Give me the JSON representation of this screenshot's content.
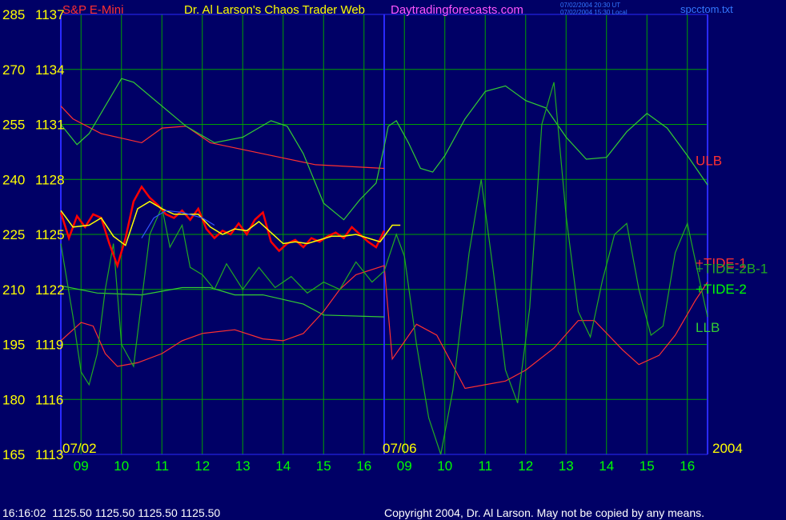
{
  "header": {
    "instrument": "S&P E-Mini",
    "title": "Dr. Al Larson's Chaos Trader Web",
    "site": "Daytradingforecasts.com",
    "timestamp_ut": "07/02/2004 20:30 UT",
    "timestamp_local": "07/02/2004 15:30 Local",
    "file": "spcctom.txt"
  },
  "footer": {
    "status": "16:16:02  1125.50 1125.50 1125.50 1125.50",
    "copyright": "Copyright 2004, Dr. Al Larson. May not be copied by any means."
  },
  "colors": {
    "background": "#000066",
    "grid": "#00a000",
    "divider": "#2a2aff",
    "price_up": "#ffffff",
    "price_down": "#ff0000",
    "channel_upper": "#ff3030",
    "channel_lower": "#33cc33",
    "tide": "#22aa22",
    "avg_blue": "#3355ff",
    "avg_yellow": "#ffff00",
    "text_yellow": "#ffff00",
    "text_green": "#00ff00",
    "text_red": "#ff3030",
    "text_magenta": "#ff55ff",
    "text_blue": "#3377ff"
  },
  "chart_data": {
    "type": "line",
    "title": "Dr. Al Larson's Chaos Trader Web",
    "ylim": [
      1113,
      1137
    ],
    "y_left_labels": [
      165,
      180,
      195,
      210,
      225,
      240,
      255,
      270,
      285
    ],
    "y_right_labels": [
      1113,
      1116,
      1119,
      1122,
      1125,
      1128,
      1131,
      1134,
      1137
    ],
    "x_range": [
      8.5,
      24.5
    ],
    "x_ticks": [
      {
        "x": 9,
        "label": "09"
      },
      {
        "x": 10,
        "label": "10"
      },
      {
        "x": 11,
        "label": "11"
      },
      {
        "x": 12,
        "label": "12"
      },
      {
        "x": 13,
        "label": "13"
      },
      {
        "x": 14,
        "label": "14"
      },
      {
        "x": 15,
        "label": "15"
      },
      {
        "x": 16,
        "label": "16"
      },
      {
        "x": 17,
        "label": "09"
      },
      {
        "x": 18,
        "label": "10"
      },
      {
        "x": 19,
        "label": "11"
      },
      {
        "x": 20,
        "label": "12"
      },
      {
        "x": 21,
        "label": "13"
      },
      {
        "x": 22,
        "label": "14"
      },
      {
        "x": 23,
        "label": "15"
      },
      {
        "x": 24,
        "label": "16"
      }
    ],
    "date_labels": [
      {
        "x": 8.5,
        "label": "07/02"
      },
      {
        "x": 16.0,
        "label": "07/06"
      },
      {
        "x": 24.5,
        "label": "2004"
      }
    ],
    "session_divider_x": 16.5,
    "series": [
      {
        "name": "ULB",
        "color": "#ff3030",
        "points": [
          [
            8.5,
            1132.0
          ],
          [
            8.8,
            1131.3
          ],
          [
            9.5,
            1130.5
          ],
          [
            10.5,
            1130.0
          ],
          [
            11.0,
            1130.8
          ],
          [
            11.6,
            1130.9
          ],
          [
            12.2,
            1130.0
          ],
          [
            13.5,
            1129.4
          ],
          [
            14.8,
            1128.8
          ],
          [
            16.5,
            1128.6
          ]
        ]
      },
      {
        "name": "LLB",
        "color": "#33cc33",
        "points": [
          [
            8.5,
            1122.2
          ],
          [
            9.4,
            1121.8
          ],
          [
            10.5,
            1121.7
          ],
          [
            11.5,
            1122.1
          ],
          [
            12.2,
            1122.1
          ],
          [
            12.8,
            1121.7
          ],
          [
            13.5,
            1121.7
          ],
          [
            14.5,
            1121.2
          ],
          [
            15.0,
            1120.6
          ],
          [
            16.5,
            1120.5
          ]
        ]
      },
      {
        "name": "TIDE-1",
        "color": "#ff3030",
        "points": [
          [
            8.5,
            1119.2
          ],
          [
            9.0,
            1120.2
          ],
          [
            9.3,
            1120.0
          ],
          [
            9.6,
            1118.5
          ],
          [
            9.9,
            1117.8
          ],
          [
            10.4,
            1118.0
          ],
          [
            11.0,
            1118.5
          ],
          [
            11.5,
            1119.2
          ],
          [
            12.0,
            1119.6
          ],
          [
            12.8,
            1119.8
          ],
          [
            13.5,
            1119.3
          ],
          [
            14.0,
            1119.2
          ],
          [
            14.5,
            1119.6
          ],
          [
            15.0,
            1120.8
          ],
          [
            15.4,
            1122.0
          ],
          [
            15.8,
            1122.8
          ],
          [
            16.5,
            1123.3
          ],
          [
            16.7,
            1118.2
          ],
          [
            17.3,
            1120.1
          ],
          [
            17.8,
            1119.5
          ],
          [
            18.5,
            1116.6
          ],
          [
            19.0,
            1116.8
          ],
          [
            19.5,
            1117.0
          ],
          [
            20.0,
            1117.6
          ],
          [
            20.7,
            1118.8
          ],
          [
            21.3,
            1120.3
          ],
          [
            21.7,
            1120.3
          ],
          [
            22.4,
            1118.7
          ],
          [
            22.8,
            1117.9
          ],
          [
            23.3,
            1118.4
          ],
          [
            23.7,
            1119.5
          ],
          [
            24.2,
            1121.4
          ],
          [
            24.5,
            1122.4
          ]
        ]
      },
      {
        "name": "TIDE-2",
        "color": "#33cc33",
        "points": [
          [
            8.5,
            1131.0
          ],
          [
            8.9,
            1129.9
          ],
          [
            9.2,
            1130.5
          ],
          [
            9.6,
            1132.0
          ],
          [
            10.0,
            1133.5
          ],
          [
            10.3,
            1133.3
          ],
          [
            11.0,
            1132.0
          ],
          [
            11.6,
            1130.9
          ],
          [
            12.3,
            1130.0
          ],
          [
            13.0,
            1130.3
          ],
          [
            13.7,
            1131.2
          ],
          [
            14.1,
            1130.9
          ],
          [
            14.5,
            1129.4
          ],
          [
            15.0,
            1126.7
          ],
          [
            15.5,
            1125.8
          ],
          [
            15.9,
            1126.9
          ],
          [
            16.3,
            1127.8
          ],
          [
            16.5,
            1129.8
          ],
          [
            16.6,
            1130.9
          ],
          [
            16.8,
            1131.2
          ],
          [
            17.1,
            1130.0
          ],
          [
            17.4,
            1128.6
          ],
          [
            17.7,
            1128.4
          ],
          [
            18.0,
            1129.3
          ],
          [
            18.5,
            1131.3
          ],
          [
            19.0,
            1132.8
          ],
          [
            19.5,
            1133.1
          ],
          [
            20.0,
            1132.3
          ],
          [
            20.5,
            1131.9
          ],
          [
            21.0,
            1130.3
          ],
          [
            21.5,
            1129.1
          ],
          [
            22.0,
            1129.2
          ],
          [
            22.5,
            1130.6
          ],
          [
            23.0,
            1131.6
          ],
          [
            23.5,
            1130.8
          ],
          [
            24.0,
            1129.3
          ],
          [
            24.5,
            1127.7
          ]
        ]
      },
      {
        "name": "TIDE-2B-1",
        "color": "#22aa22",
        "points": [
          [
            8.5,
            1124.5
          ],
          [
            8.8,
            1120.5
          ],
          [
            9.0,
            1117.5
          ],
          [
            9.2,
            1116.8
          ],
          [
            9.4,
            1118.5
          ],
          [
            9.6,
            1122.0
          ],
          [
            9.8,
            1124.5
          ],
          [
            10.0,
            1119.0
          ],
          [
            10.3,
            1117.8
          ],
          [
            10.7,
            1125.0
          ],
          [
            11.0,
            1126.5
          ],
          [
            11.2,
            1124.3
          ],
          [
            11.5,
            1125.5
          ],
          [
            11.7,
            1123.2
          ],
          [
            12.0,
            1122.8
          ],
          [
            12.3,
            1122.0
          ],
          [
            12.6,
            1123.4
          ],
          [
            13.0,
            1122.0
          ],
          [
            13.4,
            1123.2
          ],
          [
            13.8,
            1122.1
          ],
          [
            14.2,
            1122.7
          ],
          [
            14.6,
            1121.8
          ],
          [
            15.0,
            1122.4
          ],
          [
            15.4,
            1122.0
          ],
          [
            15.8,
            1123.5
          ],
          [
            16.2,
            1122.4
          ],
          [
            16.5,
            1123.0
          ],
          [
            16.8,
            1125.0
          ],
          [
            17.0,
            1123.8
          ],
          [
            17.3,
            1119.0
          ],
          [
            17.6,
            1115.0
          ],
          [
            17.9,
            1113.0
          ],
          [
            18.2,
            1116.5
          ],
          [
            18.6,
            1124.0
          ],
          [
            18.9,
            1128.0
          ],
          [
            19.2,
            1123.0
          ],
          [
            19.5,
            1117.6
          ],
          [
            19.8,
            1115.8
          ],
          [
            20.1,
            1121.0
          ],
          [
            20.4,
            1131.0
          ],
          [
            20.7,
            1133.3
          ],
          [
            21.0,
            1126.0
          ],
          [
            21.3,
            1120.8
          ],
          [
            21.6,
            1119.4
          ],
          [
            21.9,
            1122.5
          ],
          [
            22.2,
            1125.0
          ],
          [
            22.5,
            1125.6
          ],
          [
            22.8,
            1122.0
          ],
          [
            23.1,
            1119.5
          ],
          [
            23.4,
            1120.0
          ],
          [
            23.7,
            1124.0
          ],
          [
            24.0,
            1125.6
          ],
          [
            24.3,
            1122.5
          ],
          [
            24.5,
            1120.5
          ]
        ]
      },
      {
        "name": "PRICE",
        "color": "#ff0000",
        "points": [
          [
            8.5,
            1126.2
          ],
          [
            8.7,
            1124.8
          ],
          [
            8.9,
            1126.0
          ],
          [
            9.1,
            1125.4
          ],
          [
            9.3,
            1126.1
          ],
          [
            9.5,
            1125.9
          ],
          [
            9.7,
            1124.5
          ],
          [
            9.9,
            1123.3
          ],
          [
            10.1,
            1124.8
          ],
          [
            10.3,
            1126.8
          ],
          [
            10.5,
            1127.6
          ],
          [
            10.7,
            1127.0
          ],
          [
            10.9,
            1126.6
          ],
          [
            11.1,
            1126.1
          ],
          [
            11.3,
            1125.9
          ],
          [
            11.5,
            1126.3
          ],
          [
            11.7,
            1125.8
          ],
          [
            11.9,
            1126.4
          ],
          [
            12.1,
            1125.3
          ],
          [
            12.3,
            1124.8
          ],
          [
            12.5,
            1125.2
          ],
          [
            12.7,
            1125.0
          ],
          [
            12.9,
            1125.6
          ],
          [
            13.1,
            1125.0
          ],
          [
            13.3,
            1125.8
          ],
          [
            13.5,
            1126.2
          ],
          [
            13.7,
            1124.6
          ],
          [
            13.9,
            1124.1
          ],
          [
            14.1,
            1124.5
          ],
          [
            14.3,
            1124.7
          ],
          [
            14.5,
            1124.3
          ],
          [
            14.7,
            1124.8
          ],
          [
            14.9,
            1124.6
          ],
          [
            15.1,
            1124.9
          ],
          [
            15.3,
            1125.1
          ],
          [
            15.5,
            1124.8
          ],
          [
            15.7,
            1125.4
          ],
          [
            15.9,
            1125.0
          ],
          [
            16.1,
            1124.6
          ],
          [
            16.3,
            1124.3
          ],
          [
            16.5,
            1125.2
          ]
        ]
      },
      {
        "name": "AVG",
        "color": "#ffff00",
        "points": [
          [
            8.5,
            1126.3
          ],
          [
            8.8,
            1125.4
          ],
          [
            9.2,
            1125.5
          ],
          [
            9.5,
            1125.9
          ],
          [
            9.8,
            1124.9
          ],
          [
            10.1,
            1124.4
          ],
          [
            10.4,
            1126.4
          ],
          [
            10.7,
            1126.8
          ],
          [
            11.0,
            1126.4
          ],
          [
            11.3,
            1126.1
          ],
          [
            11.6,
            1126.1
          ],
          [
            11.9,
            1126.1
          ],
          [
            12.2,
            1125.4
          ],
          [
            12.5,
            1125.0
          ],
          [
            12.8,
            1125.3
          ],
          [
            13.1,
            1125.2
          ],
          [
            13.4,
            1125.7
          ],
          [
            13.7,
            1125.1
          ],
          [
            14.0,
            1124.5
          ],
          [
            14.3,
            1124.6
          ],
          [
            14.6,
            1124.5
          ],
          [
            14.9,
            1124.7
          ],
          [
            15.2,
            1124.9
          ],
          [
            15.5,
            1124.9
          ],
          [
            15.8,
            1125.0
          ],
          [
            16.1,
            1124.8
          ],
          [
            16.4,
            1124.6
          ],
          [
            16.7,
            1125.5
          ],
          [
            16.9,
            1125.5
          ]
        ]
      },
      {
        "name": "MA",
        "color": "#3355ff",
        "points": [
          [
            10.5,
            1124.8
          ],
          [
            10.8,
            1125.9
          ],
          [
            11.1,
            1126.3
          ],
          [
            11.5,
            1126.2
          ],
          [
            12.0,
            1125.9
          ],
          [
            12.3,
            1125.5
          ]
        ]
      }
    ],
    "labels": [
      {
        "text": "ULB",
        "color": "#ff3030",
        "x": 24.6,
        "y": 1129.0
      },
      {
        "text": "+TIDE-1",
        "color": "#ff3030",
        "x": 24.6,
        "y": 1123.4
      },
      {
        "text": "+TIDE-2B-1",
        "color": "#22aa22",
        "x": 24.6,
        "y": 1123.1
      },
      {
        "text": "+TIDE-2",
        "color": "#00ff00",
        "x": 24.6,
        "y": 1122.0
      },
      {
        "text": "LLB",
        "color": "#33cc33",
        "x": 24.6,
        "y": 1119.9
      }
    ]
  }
}
